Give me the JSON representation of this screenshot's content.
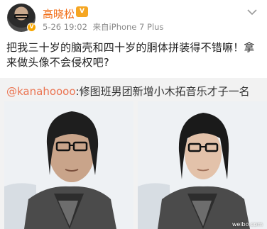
{
  "post": {
    "username": "高晓松",
    "vip_badge": "V",
    "verified_badge": "V",
    "date": "5-26 19:02",
    "source": "来自iPhone 7 Plus",
    "more_icon": "chevron-down-icon",
    "text": "把我三十岁的脑壳和四十岁的胴体拼装得不错嘛！拿来做头像不会侵权吧?"
  },
  "repost": {
    "mention": "@kanahoooo",
    "text": ":修图班男团新增小木拓音乐才子一名",
    "images": [
      {
        "name": "original-photo",
        "watermark": ""
      },
      {
        "name": "edited-photo",
        "watermark": "weibo.com"
      }
    ]
  },
  "colors": {
    "username": "#f06b14",
    "mention": "#eb7350",
    "repost_bg": "#f2f2f2",
    "meta": "#8a8a8a"
  }
}
